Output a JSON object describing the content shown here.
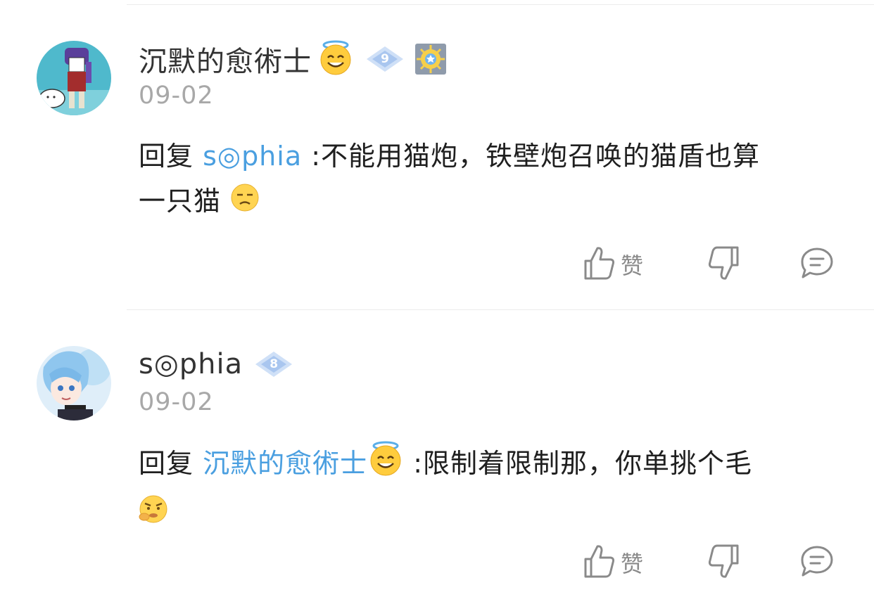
{
  "comments": [
    {
      "username": "沉默的愈術士",
      "user_emoji": "halo-smile-emoji",
      "level": "9",
      "has_medal": true,
      "date": "09-02",
      "reply_prefix": "回复",
      "reply_to": "s◎phia",
      "reply_to_emoji": "",
      "text_line1": ":不能用猫炮，铁壁炮召唤的猫盾也算",
      "text_line2": "一只猫",
      "trailing_emoji": "unamused-emoji",
      "like_label": "赞"
    },
    {
      "username": "s◎phia",
      "user_emoji": "",
      "level": "8",
      "has_medal": false,
      "date": "09-02",
      "reply_prefix": "回复",
      "reply_to": "沉默的愈術士",
      "reply_to_emoji": "halo-smile-emoji",
      "text_line1": ":限制着限制那，你单挑个毛",
      "text_line2": "",
      "trailing_emoji": "grumpy-emoji",
      "like_label": "赞"
    }
  ],
  "colors": {
    "mention": "#4a9fe0",
    "date": "#a8a8a8",
    "icon": "#8a8a8a",
    "level_badge": "#cfe0f7"
  },
  "icons": [
    "thumbs-up-icon",
    "thumbs-down-icon",
    "comment-icon"
  ]
}
